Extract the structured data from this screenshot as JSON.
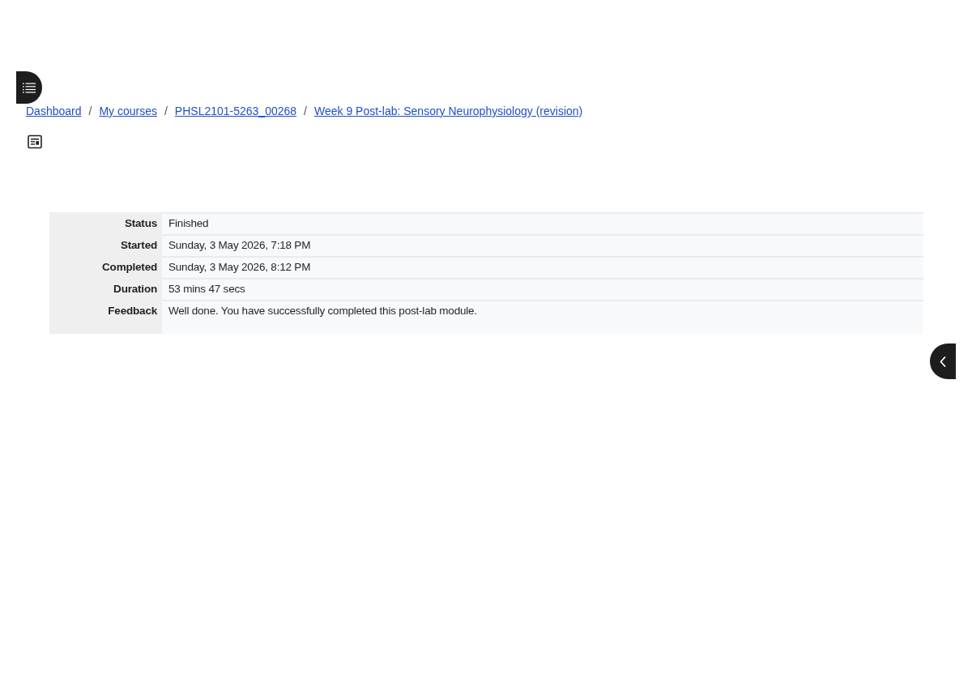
{
  "breadcrumb": [
    {
      "label": "Dashboard",
      "separator": "/"
    },
    {
      "label": "My courses",
      "separator": "/"
    },
    {
      "label": "PHSL2101-5263_00268",
      "separator": "/"
    },
    {
      "label": "Week 9 Post-lab: Sensory Neurophysiology (revision)"
    }
  ],
  "summary_table": {
    "rows": [
      {
        "label": "Status",
        "value": "Finished"
      },
      {
        "label": "Started",
        "value": "Sunday, 3 May 2026, 7:18 PM"
      },
      {
        "label": "Completed",
        "value": "Sunday, 3 May 2026, 8:12 PM"
      },
      {
        "label": "Duration",
        "value": "53 mins 47 secs"
      },
      {
        "label": "Feedback",
        "value": "Well done. You have successfully completed this post-lab module.",
        "kind": "tall"
      }
    ]
  }
}
